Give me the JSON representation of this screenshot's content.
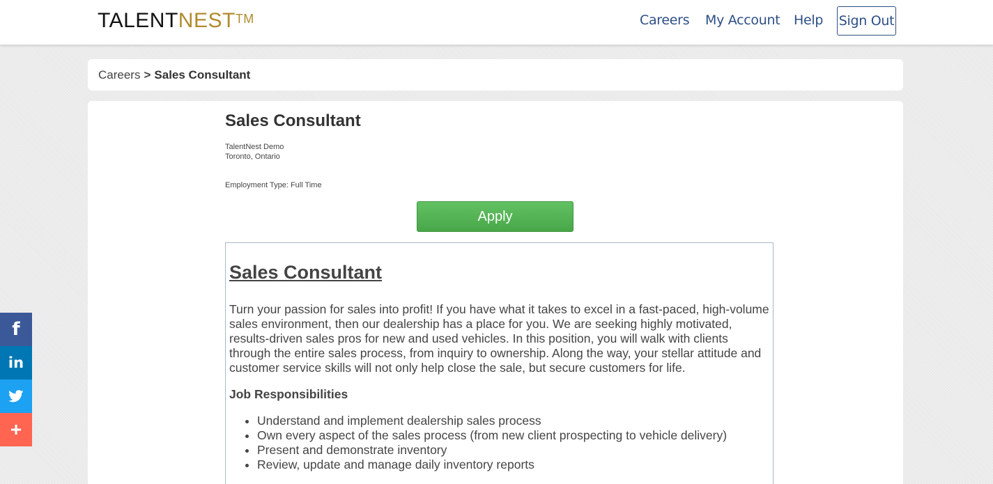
{
  "header": {
    "logo_part1": "TALENT",
    "logo_part2": "NEST",
    "logo_tm": "TM",
    "nav": {
      "careers": "Careers",
      "my_account": "My Account",
      "help": "Help",
      "sign_out": "Sign Out"
    }
  },
  "breadcrumb": {
    "parent": "Careers",
    "separator": ">",
    "current": "Sales Consultant"
  },
  "job": {
    "title": "Sales Consultant",
    "company": "TalentNest Demo",
    "location": "Toronto, Ontario",
    "employment_type": "Employment Type: Full Time",
    "apply_label": "Apply"
  },
  "description": {
    "title": "Sales Consultant",
    "intro": "Turn your passion for sales into profit! If you have what it takes to excel in a fast-paced, high-volume sales environment, then our dealership has a place for you. We are seeking highly motivated, results-driven sales pros for new and used vehicles. In this position, you will walk with clients through the entire sales process, from inquiry to ownership. Along the way, your stellar attitude and customer service skills will not only help close the sale, but secure customers for life.",
    "responsibilities_heading": "Job Responsibilities",
    "responsibilities": [
      "Understand and implement dealership sales process",
      "Own every aspect of the sales process (from new client prospecting to vehicle delivery)",
      "Present and demonstrate inventory",
      "Review, update and manage daily inventory reports"
    ]
  },
  "social": {
    "facebook_icon": "facebook-icon",
    "linkedin_icon": "linkedin-icon",
    "twitter_icon": "twitter-icon",
    "share_icon": "plus-share-icon",
    "colors": {
      "facebook": "#3b5998",
      "linkedin": "#0077b5",
      "twitter": "#1da1f2",
      "share": "#ff6550"
    }
  },
  "colors": {
    "nav_link": "#2d4f86",
    "apply_green": "#54b454",
    "logo_gold": "#b08a2e"
  }
}
